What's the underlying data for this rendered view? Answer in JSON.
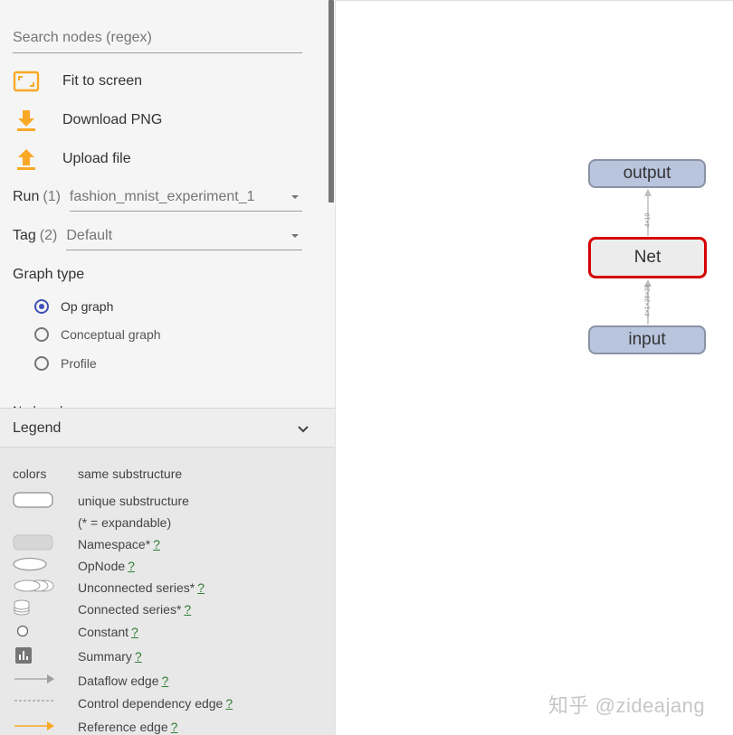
{
  "search": {
    "placeholder": "Search nodes (regex)"
  },
  "actions": {
    "fit": {
      "label": "Fit to screen",
      "icon": "fit-screen-icon"
    },
    "download": {
      "label": "Download PNG",
      "icon": "download-icon"
    },
    "upload": {
      "label": "Upload file",
      "icon": "upload-icon"
    }
  },
  "run": {
    "label": "Run",
    "count": "(1)",
    "value": "fashion_mnist_experiment_1"
  },
  "tag": {
    "label": "Tag",
    "count": "(2)",
    "value": "Default"
  },
  "graph_type": {
    "title": "Graph type",
    "options": [
      "Op graph",
      "Conceptual graph",
      "Profile"
    ],
    "selected": "Op graph"
  },
  "cut_text": "Node colors",
  "legend": {
    "title": "Legend",
    "colors_label": "colors",
    "same_substructure": "same substructure",
    "unique_substructure": "unique substructure",
    "expandable_note": "(* = expandable)",
    "namespace": "Namespace*",
    "opnode": "OpNode",
    "unconnected": "Unconnected series*",
    "connected": "Connected series*",
    "constant": "Constant",
    "summary": "Summary",
    "dataflow": "Dataflow edge",
    "control": "Control dependency edge",
    "reference": "Reference edge",
    "help": "?"
  },
  "graph": {
    "nodes": {
      "output": "output",
      "net": "Net",
      "input": "input"
    },
    "edges": {
      "top": "4×10",
      "bottom": "4×1×28×28"
    }
  },
  "watermark": "知乎 @zideajang",
  "colors": {
    "accent": "#f9a825",
    "selection": "#3f51b5",
    "node_fill": "#b9c4dd",
    "highlight": "#d50000"
  }
}
